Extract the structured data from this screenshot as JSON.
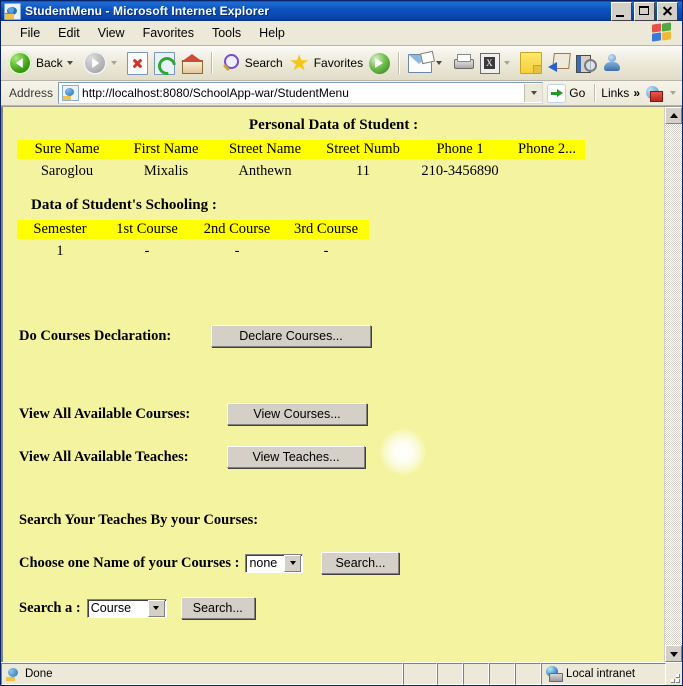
{
  "window": {
    "title": "StudentMenu - Microsoft Internet Explorer",
    "icon": "ie-document-icon",
    "minimize_label": "Minimize",
    "maximize_label": "Maximize",
    "close_label": "Close"
  },
  "menubar": {
    "items": [
      {
        "label": "File"
      },
      {
        "label": "Edit"
      },
      {
        "label": "View"
      },
      {
        "label": "Favorites"
      },
      {
        "label": "Tools"
      },
      {
        "label": "Help"
      }
    ]
  },
  "toolbar": {
    "back_label": "Back",
    "search_label": "Search",
    "favorites_label": "Favorites",
    "icons": [
      "back-arrow-icon",
      "forward-arrow-icon",
      "stop-icon",
      "refresh-icon",
      "home-icon",
      "search-icon",
      "favorites-star-icon",
      "media-icon",
      "mail-icon",
      "print-icon",
      "edit-icon",
      "notes-icon",
      "messenger-icon",
      "research-icon",
      "people-icon"
    ]
  },
  "address": {
    "label": "Address",
    "url": "http://localhost:8080/SchoolApp-war/StudentMenu",
    "go_label": "Go",
    "links_label": "Links",
    "chevron": "»"
  },
  "page": {
    "personal": {
      "title": "Personal Data of Student :",
      "headers": [
        "Sure Name",
        "First Name",
        "Street Name",
        "Street Numb",
        "Phone 1",
        "Phone 2..."
      ],
      "row": [
        "Saroglou",
        "Mixalis",
        "Anthewn",
        "11",
        "210-3456890",
        ""
      ]
    },
    "schooling": {
      "title": "Data of Student's Schooling :",
      "headers": [
        "Semester",
        "1st Course",
        "2nd Course",
        "3rd Course"
      ],
      "row": [
        "1",
        "-",
        "-",
        "-"
      ]
    },
    "actions": [
      {
        "label": "Do Courses Declaration:",
        "button": "Declare Courses..."
      },
      {
        "label": "View All Available Courses:",
        "button": "View Courses..."
      },
      {
        "label": "View All Available Teaches:",
        "button": "View Teaches..."
      }
    ],
    "search_section": {
      "title": "Search Your Teaches By your Courses:",
      "course_label": "Choose one Name of your Courses :",
      "course_select_value": "none",
      "course_search_button": "Search...",
      "type_label": "Search a :",
      "type_select_value": "Course",
      "type_search_button": "Search..."
    }
  },
  "statusbar": {
    "status": "Done",
    "zone": "Local intranet"
  }
}
